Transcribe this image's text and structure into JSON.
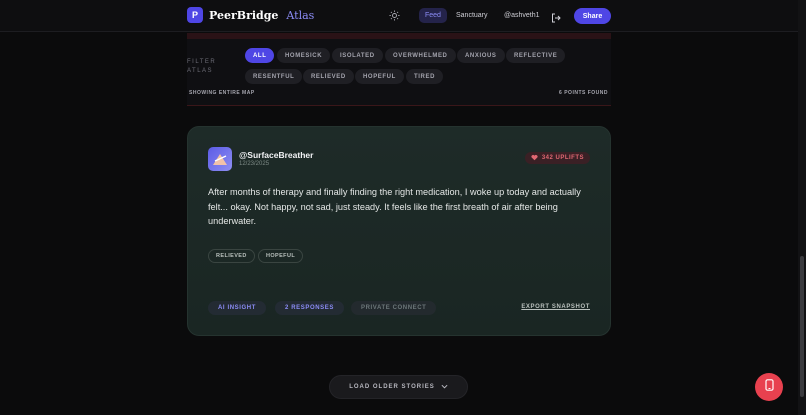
{
  "header": {
    "logo_letter": "P",
    "brand_name": "PeerBridge",
    "brand_accent": "Atlas",
    "nav": {
      "feed": "Feed",
      "sanctuary": "Sanctuary",
      "user": "@ashveth1"
    },
    "share_label": "Share",
    "icons": [
      "sun-icon",
      "logout-icon"
    ]
  },
  "atlas": {
    "filter_label": "FILTER ATLAS",
    "chips": [
      "ALL",
      "HOMESICK",
      "ISOLATED",
      "OVERWHELMED",
      "ANXIOUS",
      "REFLECTIVE",
      "RESENTFUL",
      "RELIEVED",
      "HOPEFUL",
      "TIRED"
    ],
    "active_chip": "ALL",
    "map_status": "SHOWING ENTIRE MAP",
    "points_found": "6 POINTS FOUND"
  },
  "story": {
    "handle": "@SurfaceBreather",
    "date": "12/23/2025",
    "uplifts": "342 UPLIFTS",
    "body": "After months of therapy and finally finding the right medication, I woke up today and actually felt... okay. Not happy, not sad, just steady. It feels like the first breath of air after being underwater.",
    "tags": [
      "RELIEVED",
      "HOPEFUL"
    ],
    "actions": {
      "ai_insight": "AI INSIGHT",
      "responses": "2 RESPONSES",
      "private_connect": "PRIVATE CONNECT"
    },
    "export": "EXPORT SNAPSHOT"
  },
  "load_more": "LOAD OLDER STORIES",
  "colors": {
    "accent": "#4f46e5",
    "accent_light": "#8b8cf6",
    "danger": "#e8414f",
    "card_bg": "#1e2b28"
  }
}
